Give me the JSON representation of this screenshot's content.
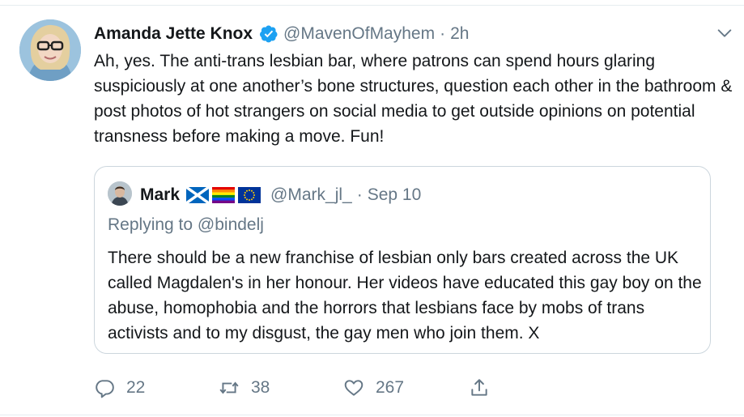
{
  "tweet": {
    "author_name": "Amanda Jette Knox",
    "handle": "@MavenOfMayhem",
    "separator": "·",
    "time": "2h",
    "text": "Ah, yes. The anti-trans lesbian bar, where patrons can spend hours glaring suspiciously at one another’s bone structures, question each other in the bathroom & post photos of hot strangers on social media to get outside opinions on potential transness before making a move. Fun!"
  },
  "quoted": {
    "author_name": "Mark",
    "handle": "@Mark_jl_",
    "separator": "·",
    "time": "Sep 10",
    "replying_prefix": "Replying to ",
    "replying_to": "@bindelj",
    "text": "There should be a new franchise of lesbian only bars created across the UK called Magdalen's in her honour. Her videos have educated this gay boy on the abuse, homophobia and the horrors that lesbians face by mobs of trans activists and to my disgust, the gay men who join them. X",
    "flags": [
      "scotland-flag",
      "rainbow-flag",
      "eu-flag"
    ]
  },
  "actions": {
    "replies": "22",
    "retweets": "38",
    "likes": "267"
  },
  "colors": {
    "text": "#14171a",
    "muted": "#657786",
    "verified": "#1da1f2",
    "border": "#ccd6dd"
  },
  "icons": [
    "verified-badge-icon",
    "chevron-down-icon",
    "reply-icon",
    "retweet-icon",
    "like-icon",
    "share-icon"
  ]
}
